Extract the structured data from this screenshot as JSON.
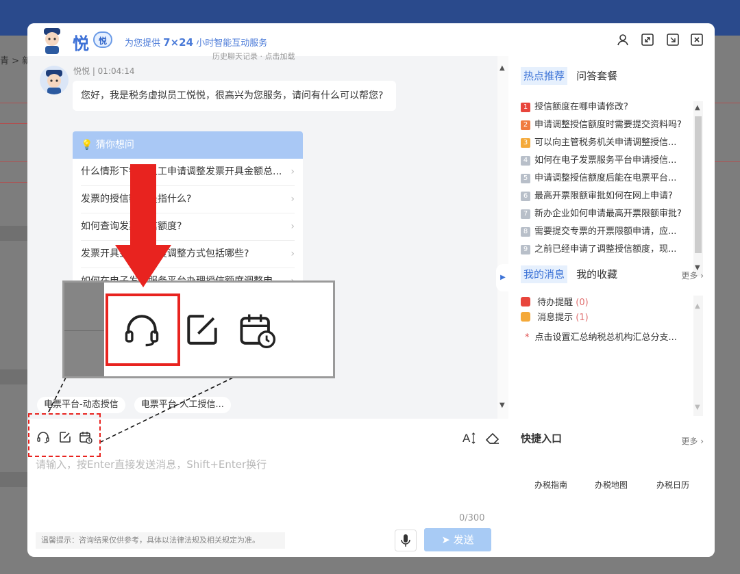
{
  "background": {
    "crumb": "青 > 新"
  },
  "header": {
    "brand": "悦",
    "badge": "悦",
    "tagline_prefix": "为您提供",
    "tagline_hours": "7×24",
    "tagline_suffix": "小时智能互动服务",
    "icons": [
      "user-icon",
      "expand-icon",
      "minimize-icon",
      "close-icon"
    ]
  },
  "chat": {
    "history_hint": "历史聊天记录 · 点击加载",
    "bot_name_time": "悦悦 | 01:04:14",
    "greeting": "您好，我是税务虚拟员工悦悦，很高兴为您服务，请问有什么可以帮您?",
    "guess": {
      "title": "猜你想问",
      "items": [
        "什么情形下需要人工申请调整发票开具金额总...",
        "发票的授信额度是指什么?",
        "如何查询发票授信额度?",
        "发票开具金额总额度调整方式包括哪些?",
        "如何在电子发票服务平台办理授信额度调整申..."
      ]
    },
    "chips": [
      "电票平台-动态授信",
      "电票平台-人工授信..."
    ]
  },
  "input": {
    "placeholder": "请输入，按Enter直接发送消息，Shift+Enter换行",
    "counter": "0/300",
    "tip": "温馨提示：咨询结果仅供参考，具体以法律法规及相关规定为准。",
    "send_label": "➤ 发送"
  },
  "right": {
    "tabs_top": [
      "热点推荐",
      "问答套餐"
    ],
    "hot": [
      {
        "n": "1",
        "color": "#e8453c",
        "text": "授信额度在哪申请修改?"
      },
      {
        "n": "2",
        "color": "#f07b3f",
        "text": "申请调整授信额度时需要提交资料吗?"
      },
      {
        "n": "3",
        "color": "#f4a93a",
        "text": "可以向主管税务机关申请调整授信..."
      },
      {
        "n": "4",
        "color": "#b8bfc9",
        "text": "如何在电子发票服务平台申请授信..."
      },
      {
        "n": "5",
        "color": "#b8bfc9",
        "text": "申请调整授信额度后能在电票平台..."
      },
      {
        "n": "6",
        "color": "#b8bfc9",
        "text": "最高开票限额审批如何在网上申请?"
      },
      {
        "n": "7",
        "color": "#b8bfc9",
        "text": "新办企业如何申请最高开票限额审批?"
      },
      {
        "n": "8",
        "color": "#b8bfc9",
        "text": "需要提交专票的开票限额申请，应..."
      },
      {
        "n": "9",
        "color": "#b8bfc9",
        "text": "之前已经申请了调整授信额度，现..."
      }
    ],
    "tabs_msg": [
      "我的消息",
      "我的收藏"
    ],
    "more": "更多",
    "messages": [
      {
        "label": "待办提醒",
        "count": "(0)",
        "color": "#e8453c"
      },
      {
        "label": "消息提示",
        "count": "(1)",
        "color": "#f4a93a"
      }
    ],
    "notice": "点击设置汇总纳税总机构汇总分支...",
    "quick_title": "快捷入口",
    "quick_links": [
      "办税指南",
      "办税地图",
      "办税日历"
    ]
  }
}
